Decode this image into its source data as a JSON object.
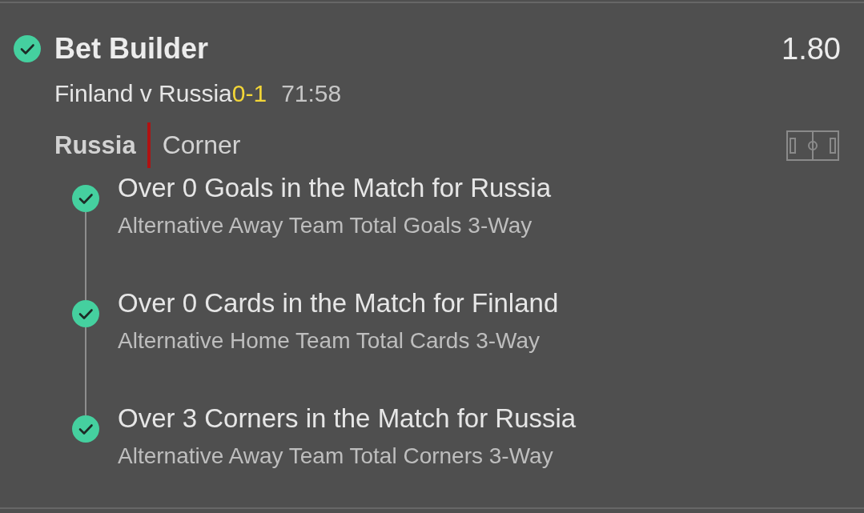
{
  "bet": {
    "won": true,
    "title": "Bet Builder",
    "odds": "1.80"
  },
  "match": {
    "teams": "Finland v Russia",
    "score": "0-1",
    "clock": "71:58"
  },
  "incident": {
    "team": "Russia",
    "event": "Corner"
  },
  "selections": [
    {
      "name": "Over 0 Goals in the Match for Russia",
      "market": "Alternative Away Team Total Goals 3-Way",
      "won": true
    },
    {
      "name": "Over 0 Cards in the Match for Finland",
      "market": "Alternative Home Team Total Cards 3-Way",
      "won": true
    },
    {
      "name": "Over 3 Corners in the Match for Russia",
      "market": "Alternative Away Team Total Corners 3-Way",
      "won": true
    }
  ]
}
